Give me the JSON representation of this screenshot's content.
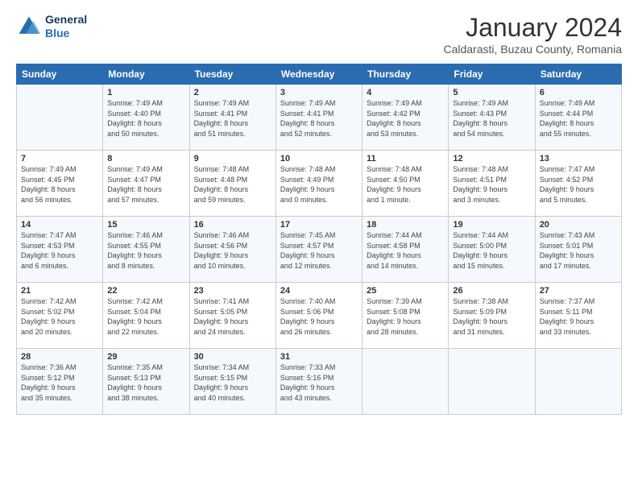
{
  "logo": {
    "line1": "General",
    "line2": "Blue"
  },
  "title": "January 2024",
  "subtitle": "Caldarasti, Buzau County, Romania",
  "weekdays": [
    "Sunday",
    "Monday",
    "Tuesday",
    "Wednesday",
    "Thursday",
    "Friday",
    "Saturday"
  ],
  "weeks": [
    [
      {
        "day": "",
        "info": ""
      },
      {
        "day": "1",
        "info": "Sunrise: 7:49 AM\nSunset: 4:40 PM\nDaylight: 8 hours\nand 50 minutes."
      },
      {
        "day": "2",
        "info": "Sunrise: 7:49 AM\nSunset: 4:41 PM\nDaylight: 8 hours\nand 51 minutes."
      },
      {
        "day": "3",
        "info": "Sunrise: 7:49 AM\nSunset: 4:41 PM\nDaylight: 8 hours\nand 52 minutes."
      },
      {
        "day": "4",
        "info": "Sunrise: 7:49 AM\nSunset: 4:42 PM\nDaylight: 8 hours\nand 53 minutes."
      },
      {
        "day": "5",
        "info": "Sunrise: 7:49 AM\nSunset: 4:43 PM\nDaylight: 8 hours\nand 54 minutes."
      },
      {
        "day": "6",
        "info": "Sunrise: 7:49 AM\nSunset: 4:44 PM\nDaylight: 8 hours\nand 55 minutes."
      }
    ],
    [
      {
        "day": "7",
        "info": "Sunrise: 7:49 AM\nSunset: 4:45 PM\nDaylight: 8 hours\nand 56 minutes."
      },
      {
        "day": "8",
        "info": "Sunrise: 7:49 AM\nSunset: 4:47 PM\nDaylight: 8 hours\nand 57 minutes."
      },
      {
        "day": "9",
        "info": "Sunrise: 7:48 AM\nSunset: 4:48 PM\nDaylight: 8 hours\nand 59 minutes."
      },
      {
        "day": "10",
        "info": "Sunrise: 7:48 AM\nSunset: 4:49 PM\nDaylight: 9 hours\nand 0 minutes."
      },
      {
        "day": "11",
        "info": "Sunrise: 7:48 AM\nSunset: 4:50 PM\nDaylight: 9 hours\nand 1 minute."
      },
      {
        "day": "12",
        "info": "Sunrise: 7:48 AM\nSunset: 4:51 PM\nDaylight: 9 hours\nand 3 minutes."
      },
      {
        "day": "13",
        "info": "Sunrise: 7:47 AM\nSunset: 4:52 PM\nDaylight: 9 hours\nand 5 minutes."
      }
    ],
    [
      {
        "day": "14",
        "info": "Sunrise: 7:47 AM\nSunset: 4:53 PM\nDaylight: 9 hours\nand 6 minutes."
      },
      {
        "day": "15",
        "info": "Sunrise: 7:46 AM\nSunset: 4:55 PM\nDaylight: 9 hours\nand 8 minutes."
      },
      {
        "day": "16",
        "info": "Sunrise: 7:46 AM\nSunset: 4:56 PM\nDaylight: 9 hours\nand 10 minutes."
      },
      {
        "day": "17",
        "info": "Sunrise: 7:45 AM\nSunset: 4:57 PM\nDaylight: 9 hours\nand 12 minutes."
      },
      {
        "day": "18",
        "info": "Sunrise: 7:44 AM\nSunset: 4:58 PM\nDaylight: 9 hours\nand 14 minutes."
      },
      {
        "day": "19",
        "info": "Sunrise: 7:44 AM\nSunset: 5:00 PM\nDaylight: 9 hours\nand 15 minutes."
      },
      {
        "day": "20",
        "info": "Sunrise: 7:43 AM\nSunset: 5:01 PM\nDaylight: 9 hours\nand 17 minutes."
      }
    ],
    [
      {
        "day": "21",
        "info": "Sunrise: 7:42 AM\nSunset: 5:02 PM\nDaylight: 9 hours\nand 20 minutes."
      },
      {
        "day": "22",
        "info": "Sunrise: 7:42 AM\nSunset: 5:04 PM\nDaylight: 9 hours\nand 22 minutes."
      },
      {
        "day": "23",
        "info": "Sunrise: 7:41 AM\nSunset: 5:05 PM\nDaylight: 9 hours\nand 24 minutes."
      },
      {
        "day": "24",
        "info": "Sunrise: 7:40 AM\nSunset: 5:06 PM\nDaylight: 9 hours\nand 26 minutes."
      },
      {
        "day": "25",
        "info": "Sunrise: 7:39 AM\nSunset: 5:08 PM\nDaylight: 9 hours\nand 28 minutes."
      },
      {
        "day": "26",
        "info": "Sunrise: 7:38 AM\nSunset: 5:09 PM\nDaylight: 9 hours\nand 31 minutes."
      },
      {
        "day": "27",
        "info": "Sunrise: 7:37 AM\nSunset: 5:11 PM\nDaylight: 9 hours\nand 33 minutes."
      }
    ],
    [
      {
        "day": "28",
        "info": "Sunrise: 7:36 AM\nSunset: 5:12 PM\nDaylight: 9 hours\nand 35 minutes."
      },
      {
        "day": "29",
        "info": "Sunrise: 7:35 AM\nSunset: 5:13 PM\nDaylight: 9 hours\nand 38 minutes."
      },
      {
        "day": "30",
        "info": "Sunrise: 7:34 AM\nSunset: 5:15 PM\nDaylight: 9 hours\nand 40 minutes."
      },
      {
        "day": "31",
        "info": "Sunrise: 7:33 AM\nSunset: 5:16 PM\nDaylight: 9 hours\nand 43 minutes."
      },
      {
        "day": "",
        "info": ""
      },
      {
        "day": "",
        "info": ""
      },
      {
        "day": "",
        "info": ""
      }
    ]
  ]
}
